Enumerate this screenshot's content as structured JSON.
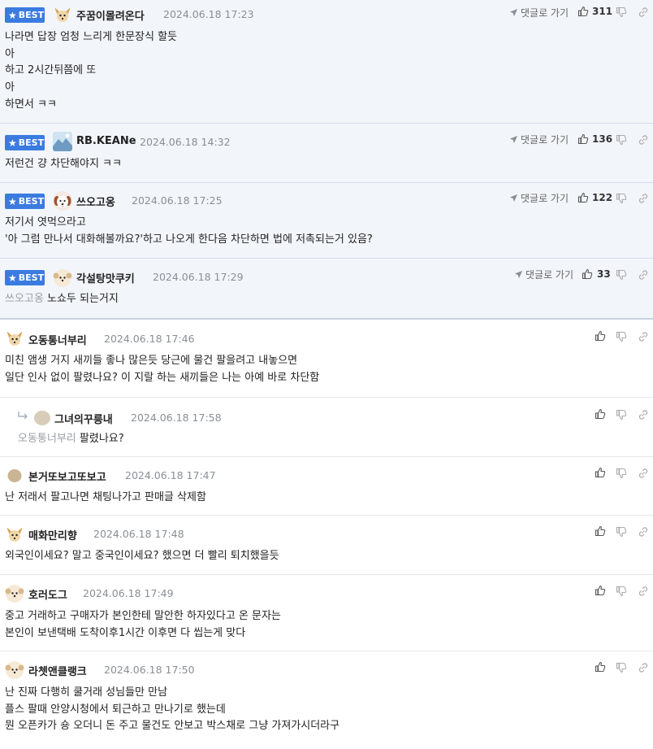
{
  "labels": {
    "best": "BEST",
    "reply_to": "댓글로 가기"
  },
  "colors": {
    "best_bg": "#f2f6fb",
    "badge": "#3b7be0",
    "date": "#8a8f96",
    "mention": "#9aa0a6"
  },
  "icons": {
    "like": "thumbs-up-icon",
    "dislike": "thumbs-down-icon",
    "link": "chain-link-icon",
    "reply": "paper-plane-icon",
    "reply_arrow": "reply-arrow-icon"
  },
  "best_comments": [
    {
      "nick": "주꿈이몰려온다",
      "date": "2024.06.18 17:23",
      "likes": "311",
      "lines": [
        "나라면 답장 엄청 느리게 한문장식 할듯",
        "아",
        "하고 2시간뒤쯤에 또",
        "아",
        "하면서 ㅋㅋ"
      ]
    },
    {
      "nick": "RB.KEANe",
      "date": "2024.06.18 14:32",
      "likes": "136",
      "lines": [
        "저런건 걍 차단해야지 ㅋㅋ"
      ]
    },
    {
      "nick": "쓰오고옹",
      "date": "2024.06.18 17:25",
      "likes": "122",
      "lines": [
        "저기서 엿먹으라고",
        "'아 그럼 만나서 대화해볼까요?'하고 나오게 한다음 차단하면 법에 저촉되는거 있음?"
      ]
    },
    {
      "nick": "각설탕맛쿠키",
      "date": "2024.06.18 17:29",
      "likes": "33",
      "mention": "쓰오고옹",
      "lines": [
        "노쇼두 되는거지"
      ]
    }
  ],
  "comments": [
    {
      "nick": "오동통너부리",
      "date": "2024.06.18 17:46",
      "lines": [
        "미친 앰생 거지 새끼들 좋나 많은듯 당근에 물건 팔을려고 내놓으면",
        "일단 인사 없이 팔렸나요? 이 지랄 하는 새끼들은 나는 아예 바로 차단함"
      ]
    },
    {
      "nick": "그녀의꾸릉내",
      "date": "2024.06.18 17:58",
      "reply": true,
      "mention": "오동통너부리",
      "lines": [
        "팔렸나요?"
      ]
    },
    {
      "nick": "본거또보고또보고",
      "date": "2024.06.18 17:47",
      "lines": [
        "난 저래서 팔고나면 채팅나가고 판매글 삭제함"
      ]
    },
    {
      "nick": "매화만리향",
      "date": "2024.06.18 17:48",
      "lines": [
        "외국인이세요? 말고 중국인이세요? 했으면 더 빨리 퇴치했을듯"
      ]
    },
    {
      "nick": "호러도그",
      "date": "2024.06.18 17:49",
      "lines": [
        "중고 거래하고 구매자가 본인한테 말안한 하자있다고 온 문자는",
        "본인이 보낸택배 도착이후1시간 이후면 다 씹는게 맞다"
      ]
    },
    {
      "nick": "라쳇앤클랭크",
      "date": "2024.06.18 17:50",
      "lines": [
        "난 진짜 다행히 쿨거래 성님들만 만남",
        "플스 팔때 안양시청에서 퇴근하고 만나기로 했는데",
        "뭔 오픈카가 숑 오더니 돈 주고 물건도 안보고 박스채로 그냥 가져가시더라구"
      ]
    }
  ]
}
